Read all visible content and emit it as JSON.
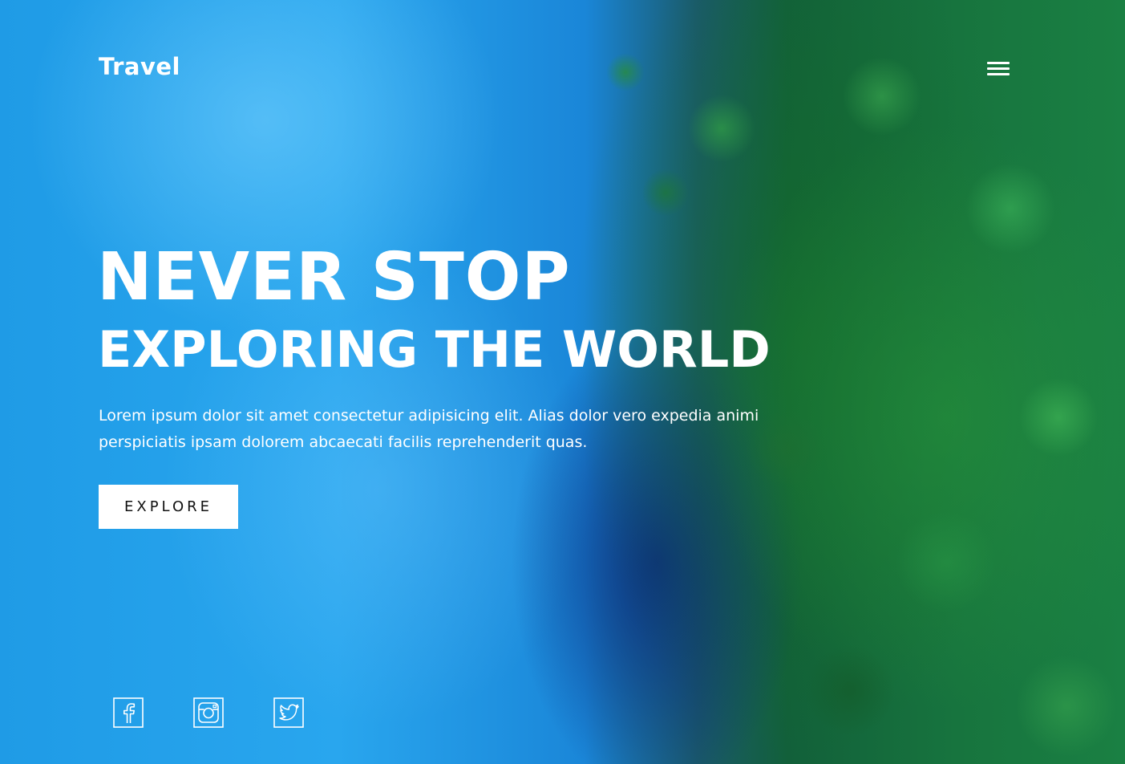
{
  "header": {
    "logo": "Travel",
    "menu_icon": "hamburger-menu-icon"
  },
  "hero": {
    "headline_line1": "NEVER STOP",
    "headline_line2": "EXPLORING THE WORLD",
    "description": "Lorem ipsum dolor sit amet consectetur adipisicing elit. Alias dolor vero expedia animi perspiciatis ipsam dolorem abcaecati facilis reprehenderit quas.",
    "cta_label": "EXPLORE"
  },
  "social": [
    {
      "icon": "facebook-icon"
    },
    {
      "icon": "instagram-icon"
    },
    {
      "icon": "twitter-icon"
    }
  ],
  "colors": {
    "text": "#ffffff",
    "button_bg": "#ffffff",
    "button_text": "#111111",
    "water_blue": "#1f9be6",
    "foliage_green": "#17743e"
  }
}
